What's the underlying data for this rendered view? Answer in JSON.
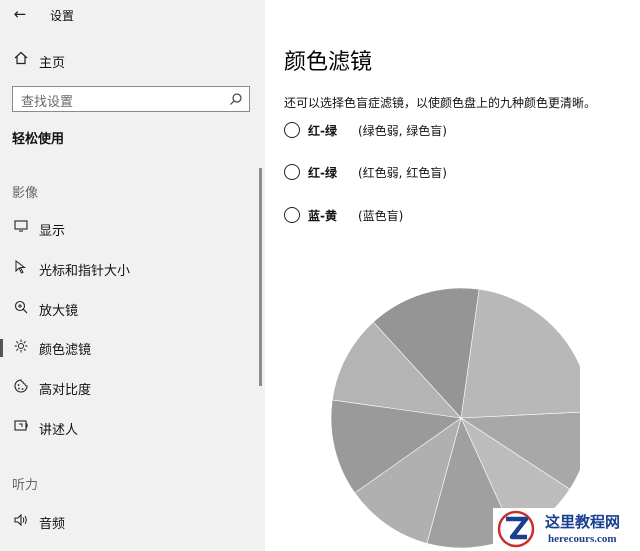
{
  "window": {
    "back_icon": "←",
    "title": "设置"
  },
  "sidebar": {
    "home": {
      "label": "主页",
      "icon": "home-icon"
    },
    "search": {
      "placeholder": "查找设置",
      "icon": "search-icon"
    },
    "section_title": "轻松使用",
    "groups": [
      {
        "label": "影像"
      },
      {
        "label": "听力"
      }
    ],
    "items": [
      {
        "label": "显示",
        "icon": "display-icon",
        "glyph": "▭"
      },
      {
        "label": "光标和指针大小",
        "icon": "pointer-icon",
        "glyph": "↖"
      },
      {
        "label": "放大镜",
        "icon": "magnifier-icon",
        "glyph": "⊕"
      },
      {
        "label": "颜色滤镜",
        "icon": "color-filter-icon",
        "glyph": "☼",
        "active": true
      },
      {
        "label": "高对比度",
        "icon": "high-contrast-icon",
        "glyph": "◐"
      },
      {
        "label": "讲述人",
        "icon": "narrator-icon",
        "glyph": "▣"
      },
      {
        "label": "音频",
        "icon": "audio-icon",
        "glyph": "🔈"
      }
    ]
  },
  "main": {
    "title": "颜色滤镜",
    "description": "还可以选择色盲症滤镜，以使颜色盘上的九种颜色更清晰。",
    "options": [
      {
        "bold": "红-绿",
        "sub": "(绿色弱, 绿色盲)"
      },
      {
        "bold": "红-绿",
        "sub": "(红色弱, 红色盲)"
      },
      {
        "bold": "蓝-黄",
        "sub": "(蓝色盲)"
      }
    ]
  },
  "color_wheel": {
    "slices": [
      {
        "fraction": 0.22,
        "color": "#b8b8b8"
      },
      {
        "fraction": 0.1,
        "color": "#a8a8a8"
      },
      {
        "fraction": 0.09,
        "color": "#bcbcbc"
      },
      {
        "fraction": 0.11,
        "color": "#a0a0a0"
      },
      {
        "fraction": 0.11,
        "color": "#b0b0b0"
      },
      {
        "fraction": 0.12,
        "color": "#9a9a9a"
      },
      {
        "fraction": 0.11,
        "color": "#b4b4b4"
      },
      {
        "fraction": 0.14,
        "color": "#959595"
      }
    ]
  },
  "watermark": {
    "cn": "这里教程网",
    "en": "herecours.com"
  },
  "colors": {
    "sidebar_bg": "#f1f1f1",
    "accent": "#555555",
    "watermark_blue": "#1b3f8f"
  }
}
